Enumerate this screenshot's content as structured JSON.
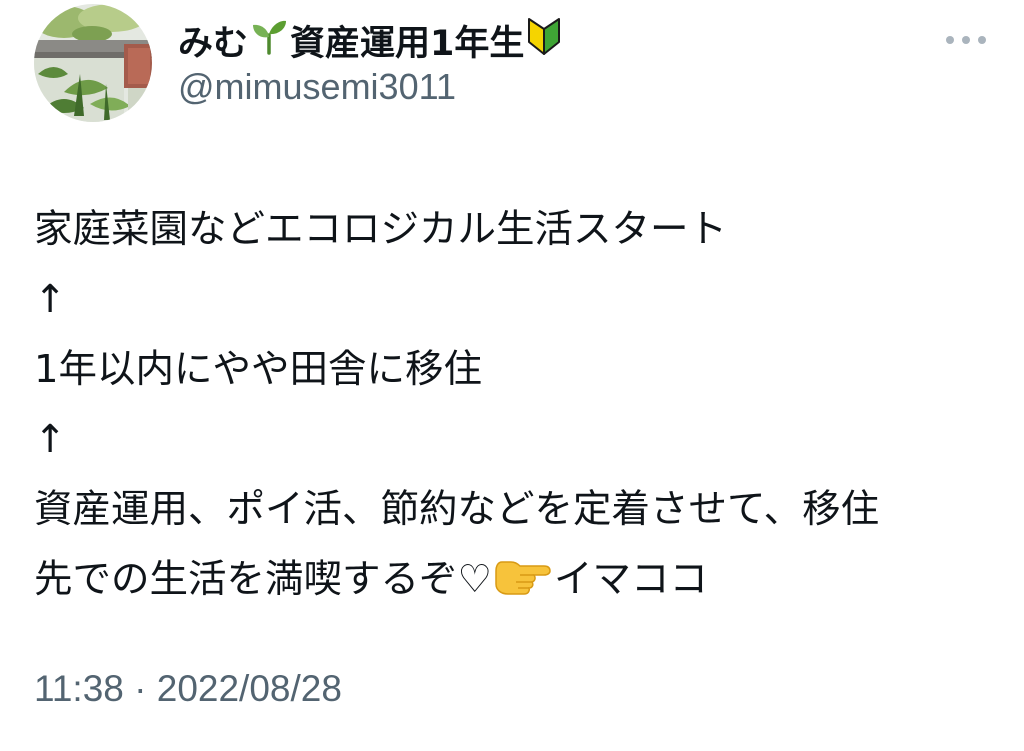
{
  "author": {
    "name_prefix": "みむ",
    "name_main": "資産運用1年生",
    "handle": "@mimusemi3011",
    "name_icons": [
      "seedling-icon",
      "beginner-mark-icon"
    ]
  },
  "tweet": {
    "lines": [
      "家庭菜園などエコロジカル生活スタート",
      "↑",
      "1年以内にやや田舎に移住",
      "↑",
      "資産運用、ポイ活、節約などを定着させて、移住",
      "先での生活を満喫するぞ♡"
    ],
    "trailing_text": "イマココ",
    "trailing_icon": "pointing-hand-icon"
  },
  "meta": {
    "time": "11:38",
    "separator": "·",
    "date": "2022/08/28"
  },
  "icons": {
    "more": "more-horizontal-icon"
  },
  "colors": {
    "text_primary": "#0f1419",
    "text_secondary": "#536471",
    "more_icon": "#aab4bd"
  }
}
